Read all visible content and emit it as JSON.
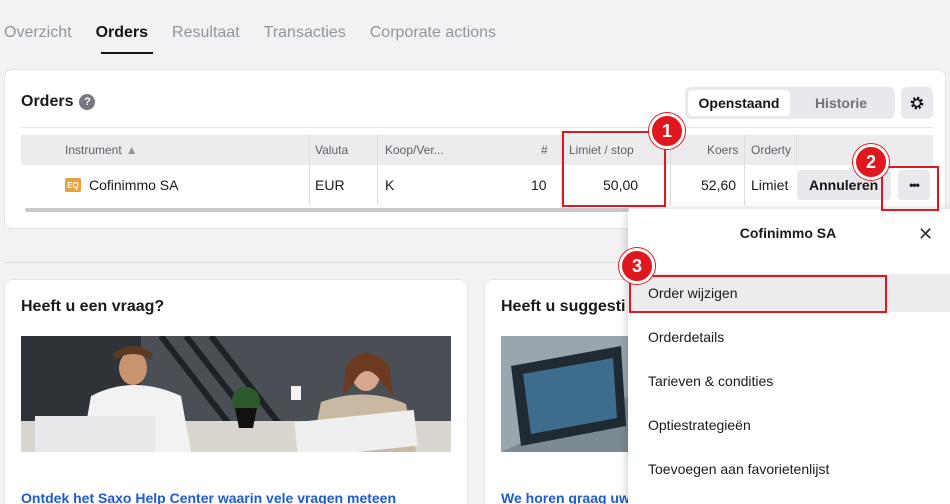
{
  "tabs": [
    {
      "label": "Overzicht"
    },
    {
      "label": "Orders"
    },
    {
      "label": "Resultaat"
    },
    {
      "label": "Transacties"
    },
    {
      "label": "Corporate actions"
    }
  ],
  "orders": {
    "title": "Orders",
    "help_glyph": "?",
    "segments": {
      "open": "Openstaand",
      "history": "Historie"
    },
    "columns": {
      "instrument": "Instrument",
      "sort_glyph": "▲",
      "currency": "Valuta",
      "side": "Koop/Ver...",
      "qty": "#",
      "limit": "Limiet / stop",
      "price": "Koers",
      "type": "Orderty"
    },
    "row": {
      "badge": "EQ",
      "instrument": "Cofinimmo SA",
      "currency": "EUR",
      "side": "K",
      "qty": "10",
      "limit": "50,00",
      "price": "52,60",
      "type": "Limiet",
      "cancel": "Annuleren",
      "more": "•••"
    }
  },
  "help_card": {
    "title": "Heeft u een vraag?",
    "link": "Ontdek het Saxo Help Center waarin vele vragen meteen"
  },
  "suggestion_card": {
    "title": "Heeft u suggesti",
    "link": "We horen graag uw"
  },
  "popover": {
    "title": "Cofinimmo SA",
    "close_glyph": "✕",
    "items": [
      {
        "label": "Order wijzigen"
      },
      {
        "label": "Orderdetails"
      },
      {
        "label": "Tarieven & condities"
      },
      {
        "label": "Optiestrategieën"
      },
      {
        "label": "Toevoegen aan favorietenlijst"
      }
    ]
  },
  "annotations": {
    "step1": "1",
    "step2": "2",
    "step3": "3",
    "color": "#e0181e"
  }
}
